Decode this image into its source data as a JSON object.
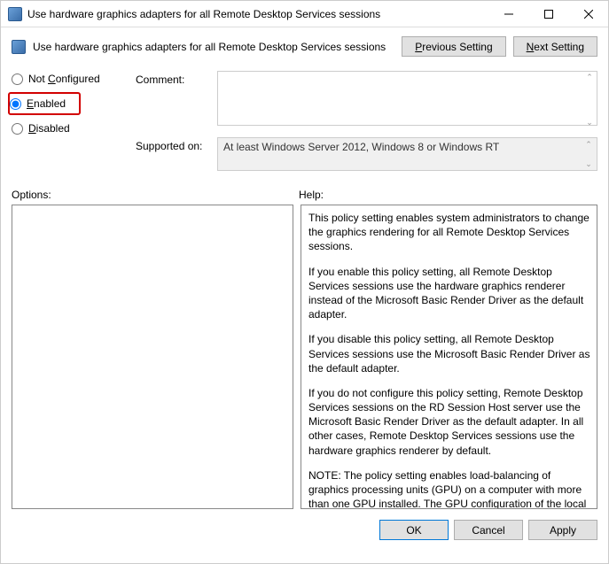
{
  "titlebar": {
    "title": "Use hardware graphics adapters for all Remote Desktop Services sessions"
  },
  "header": {
    "title": "Use hardware graphics adapters for all Remote Desktop Services sessions",
    "previous_label": "Previous Setting",
    "previous_ul": "P",
    "next_label": "Next Setting",
    "next_ul": "N"
  },
  "radios": {
    "not_configured": "Not Configured",
    "not_configured_ul": "C",
    "enabled": "Enabled",
    "enabled_ul": "E",
    "disabled": "Disabled",
    "disabled_ul": "D",
    "selected": "enabled"
  },
  "fields": {
    "comment_label": "Comment:",
    "comment_value": "",
    "supported_label": "Supported on:",
    "supported_value": "At least Windows Server 2012, Windows 8 or Windows RT"
  },
  "panels": {
    "options_label": "Options:",
    "help_label": "Help:"
  },
  "help": {
    "p1": "This policy setting enables system administrators to change the graphics rendering for all Remote Desktop Services sessions.",
    "p2": "If you enable this policy setting, all Remote Desktop Services sessions use the hardware graphics renderer instead of the Microsoft Basic Render Driver as the default adapter.",
    "p3": "If you disable this policy setting, all Remote Desktop Services sessions use the Microsoft Basic Render Driver as the default adapter.",
    "p4": "If you do not configure this policy setting, Remote Desktop Services sessions on the RD Session Host server use the Microsoft Basic Render Driver as the default adapter. In all other cases, Remote Desktop Services sessions use the hardware graphics renderer by default.",
    "p5": "NOTE: The policy setting enables load-balancing of graphics processing units (GPU) on a computer with more than one GPU installed. The GPU configuration of the local session is not affected by this policy setting."
  },
  "buttons": {
    "ok": "OK",
    "cancel": "Cancel",
    "apply": "Apply"
  }
}
